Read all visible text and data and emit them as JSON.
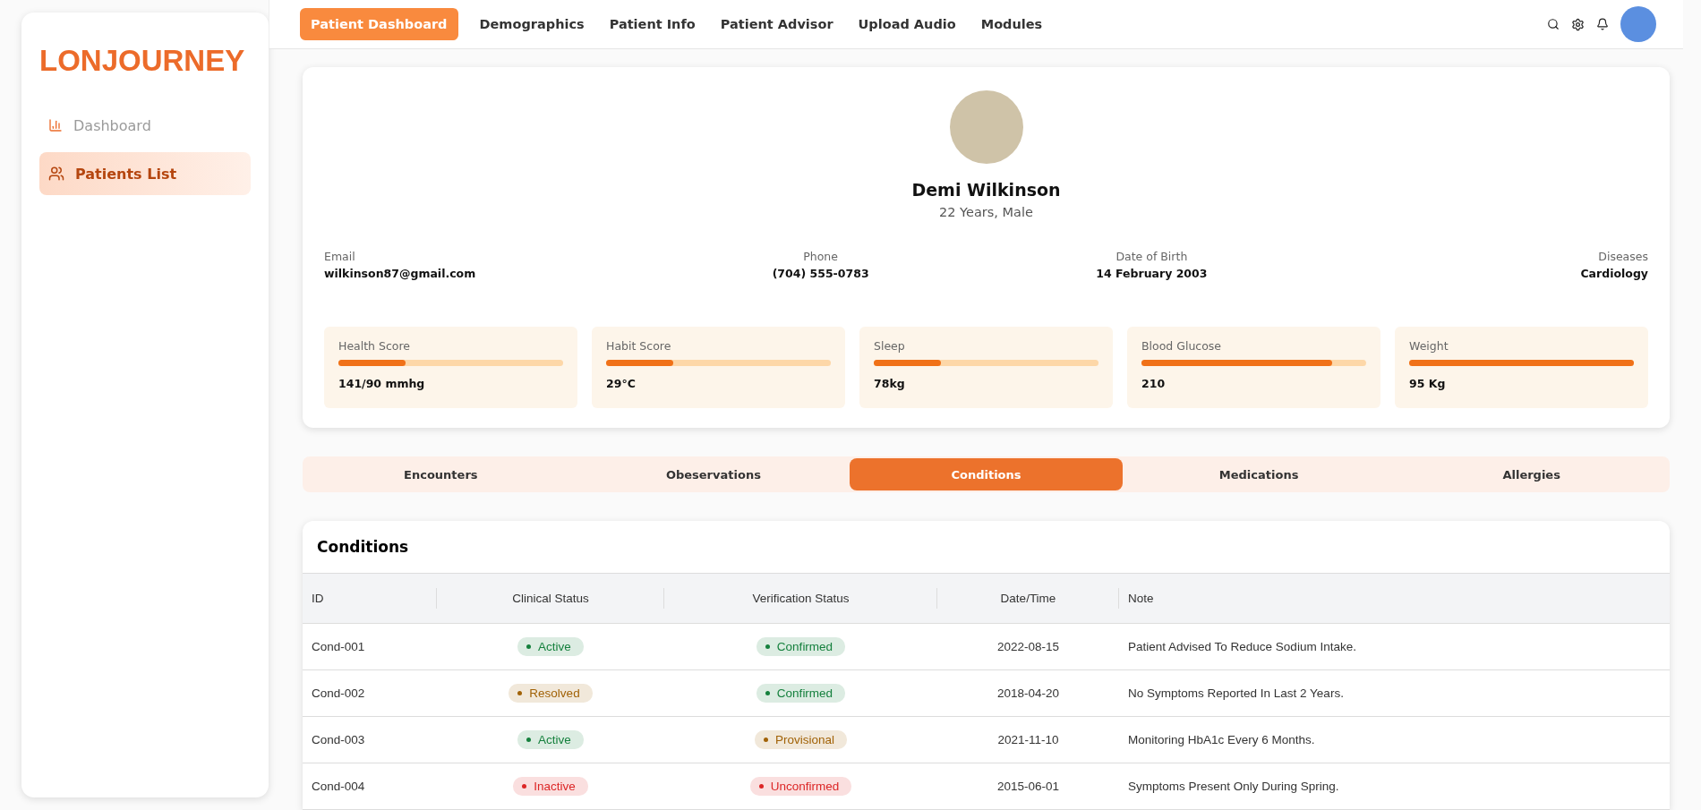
{
  "brand": "LONJOURNEY",
  "sidebar": {
    "items": [
      {
        "label": "Dashboard",
        "kind": "chart",
        "selected": false
      },
      {
        "label": "Patients List",
        "kind": "users",
        "selected": true
      }
    ]
  },
  "nav": [
    {
      "label": "Patient Dashboard",
      "selected": true
    },
    {
      "label": "Demographics",
      "selected": false
    },
    {
      "label": "Patient Info",
      "selected": false
    },
    {
      "label": "Patient Advisor",
      "selected": false
    },
    {
      "label": "Upload Audio",
      "selected": false
    },
    {
      "label": "Modules",
      "selected": false
    }
  ],
  "patient": {
    "name": "Demi Wilkinson",
    "subtitle": "22 Years, Male",
    "fields": [
      {
        "label": "Email",
        "value": "wilkinson87@gmail.com"
      },
      {
        "label": "Phone",
        "value": "(704) 555-0783"
      },
      {
        "label": "Date of Birth",
        "value": "14 February 2003"
      },
      {
        "label": "Diseases",
        "value": "Cardiology"
      }
    ],
    "metrics": [
      {
        "label": "Health Score",
        "level": 0.3,
        "value": "141/90 mmhg"
      },
      {
        "label": "Habit Score",
        "level": 0.3,
        "value": "29°C"
      },
      {
        "label": "Sleep",
        "level": 0.3,
        "value": "78kg"
      },
      {
        "label": "Blood Glucose",
        "level": 0.85,
        "value": "210"
      },
      {
        "label": "Weight",
        "level": 1,
        "value": "95 Kg"
      }
    ]
  },
  "tabs": [
    {
      "label": "Encounters",
      "selected": false
    },
    {
      "label": "Obeservations",
      "selected": false
    },
    {
      "label": "Conditions",
      "selected": true
    },
    {
      "label": "Medications",
      "selected": false
    },
    {
      "label": "Allergies",
      "selected": false
    }
  ],
  "table": {
    "title": "Conditions",
    "columns": [
      "ID",
      "Clinical Status",
      "Verification Status",
      "Date/Time",
      "Note"
    ],
    "rows": [
      {
        "id": "Cond-001",
        "clinical": {
          "label": "Active",
          "color": "#15803d"
        },
        "verification": {
          "label": "Confirmed",
          "color": "#15803d"
        },
        "date": "2022-08-15",
        "note": "Patient Advised To Reduce Sodium Intake."
      },
      {
        "id": "Cond-002",
        "clinical": {
          "label": "Resolved",
          "color": "#a16207"
        },
        "verification": {
          "label": "Confirmed",
          "color": "#15803d"
        },
        "date": "2018-04-20",
        "note": "No Symptoms Reported In Last 2 Years."
      },
      {
        "id": "Cond-003",
        "clinical": {
          "label": "Active",
          "color": "#15803d"
        },
        "verification": {
          "label": "Provisional",
          "color": "#a16207"
        },
        "date": "2021-11-10",
        "note": "Monitoring HbA1c Every 6 Months."
      },
      {
        "id": "Cond-004",
        "clinical": {
          "label": "Inactive",
          "color": "#dc2626"
        },
        "verification": {
          "label": "Unconfirmed",
          "color": "#dc2626"
        },
        "date": "2015-06-01",
        "note": "Symptoms Present Only During Spring."
      }
    ]
  }
}
